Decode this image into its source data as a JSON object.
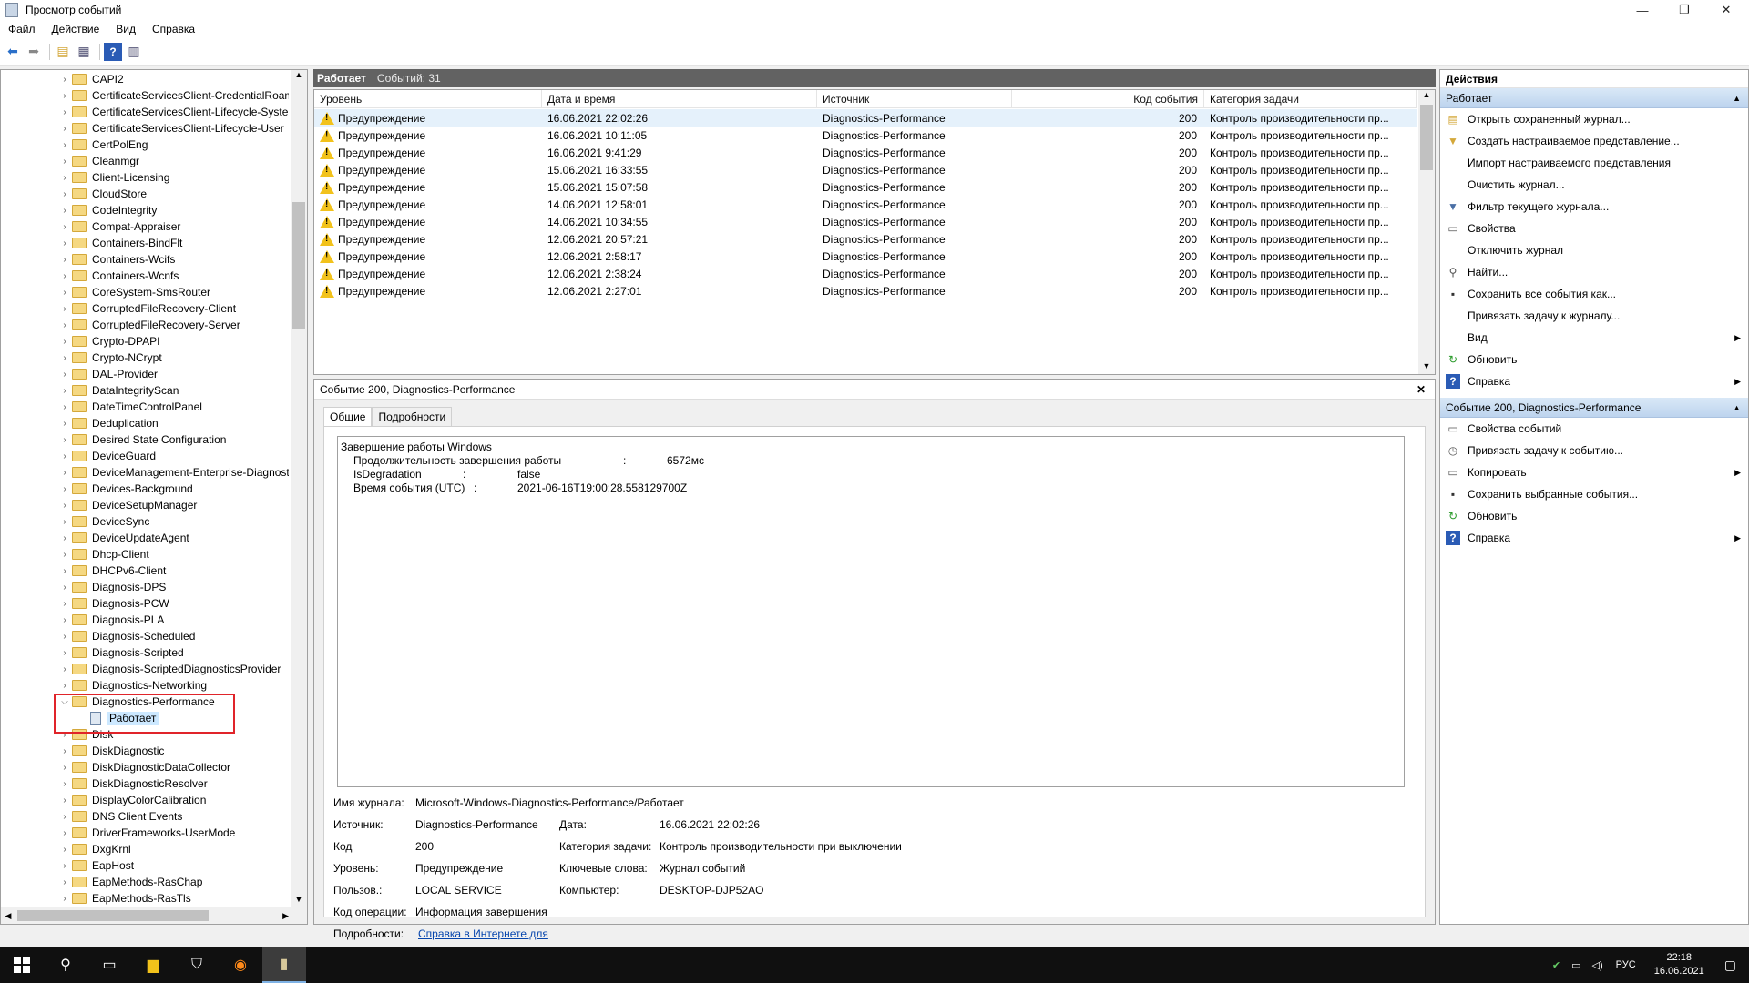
{
  "window": {
    "title": "Просмотр событий",
    "min_label": "—",
    "max_label": "❐",
    "close_label": "✕"
  },
  "menu": [
    "Файл",
    "Действие",
    "Вид",
    "Справка"
  ],
  "toolbar": [
    "back-icon",
    "forward-icon",
    "folder-up-icon",
    "show-hide-tree-icon",
    "help-icon",
    "show-hide-action-pane-icon"
  ],
  "tree": [
    "CAPI2",
    "CertificateServicesClient-CredentialRoam",
    "CertificateServicesClient-Lifecycle-System",
    "CertificateServicesClient-Lifecycle-User",
    "CertPolEng",
    "Cleanmgr",
    "Client-Licensing",
    "CloudStore",
    "CodeIntegrity",
    "Compat-Appraiser",
    "Containers-BindFlt",
    "Containers-Wcifs",
    "Containers-Wcnfs",
    "CoreSystem-SmsRouter",
    "CorruptedFileRecovery-Client",
    "CorruptedFileRecovery-Server",
    "Crypto-DPAPI",
    "Crypto-NCrypt",
    "DAL-Provider",
    "DataIntegrityScan",
    "DateTimeControlPanel",
    "Deduplication",
    "Desired State Configuration",
    "DeviceGuard",
    "DeviceManagement-Enterprise-Diagnosti",
    "Devices-Background",
    "DeviceSetupManager",
    "DeviceSync",
    "DeviceUpdateAgent",
    "Dhcp-Client",
    "DHCPv6-Client",
    "Diagnosis-DPS",
    "Diagnosis-PCW",
    "Diagnosis-PLA",
    "Diagnosis-Scheduled",
    "Diagnosis-Scripted",
    "Diagnosis-ScriptedDiagnosticsProvider",
    "Diagnostics-Networking",
    "Diagnostics-Performance",
    "Работает",
    "Disk",
    "DiskDiagnostic",
    "DiskDiagnosticDataCollector",
    "DiskDiagnosticResolver",
    "DisplayColorCalibration",
    "DNS Client Events",
    "DriverFrameworks-UserMode",
    "DxgKrnl",
    "EapHost",
    "EapMethods-RasChap",
    "EapMethods-RasTls"
  ],
  "list": {
    "name": "Работает",
    "count": "Событий: 31",
    "columns": [
      "Уровень",
      "Дата и время",
      "Источник",
      "Код события",
      "Категория задачи"
    ],
    "rows": [
      [
        "Предупреждение",
        "16.06.2021 22:02:26",
        "Diagnostics-Performance",
        "200",
        "Контроль производительности пр..."
      ],
      [
        "Предупреждение",
        "16.06.2021 10:11:05",
        "Diagnostics-Performance",
        "200",
        "Контроль производительности пр..."
      ],
      [
        "Предупреждение",
        "16.06.2021 9:41:29",
        "Diagnostics-Performance",
        "200",
        "Контроль производительности пр..."
      ],
      [
        "Предупреждение",
        "15.06.2021 16:33:55",
        "Diagnostics-Performance",
        "200",
        "Контроль производительности пр..."
      ],
      [
        "Предупреждение",
        "15.06.2021 15:07:58",
        "Diagnostics-Performance",
        "200",
        "Контроль производительности пр..."
      ],
      [
        "Предупреждение",
        "14.06.2021 12:58:01",
        "Diagnostics-Performance",
        "200",
        "Контроль производительности пр..."
      ],
      [
        "Предупреждение",
        "14.06.2021 10:34:55",
        "Diagnostics-Performance",
        "200",
        "Контроль производительности пр..."
      ],
      [
        "Предупреждение",
        "12.06.2021 20:57:21",
        "Diagnostics-Performance",
        "200",
        "Контроль производительности пр..."
      ],
      [
        "Предупреждение",
        "12.06.2021 2:58:17",
        "Diagnostics-Performance",
        "200",
        "Контроль производительности пр..."
      ],
      [
        "Предупреждение",
        "12.06.2021 2:38:24",
        "Diagnostics-Performance",
        "200",
        "Контроль производительности пр..."
      ],
      [
        "Предупреждение",
        "12.06.2021 2:27:01",
        "Diagnostics-Performance",
        "200",
        "Контроль производительности пр..."
      ]
    ]
  },
  "detail": {
    "title": "Событие 200, Diagnostics-Performance",
    "close": "✕",
    "tab_general": "Общие",
    "tab_details": "Подробности",
    "desc": {
      "heading": "Завершение работы Windows",
      "l1k": "Продолжительность завершения работы",
      "l1v": "6572мс",
      "l2k": "IsDegradation",
      "l2v": "false",
      "l3k": "Время события (UTC)",
      "l3v": "2021-06-16T19:00:28.558129700Z",
      "sep": ":"
    },
    "props": {
      "log_k": "Имя журнала:",
      "log_v": "Microsoft-Windows-Diagnostics-Performance/Работает",
      "src_k": "Источник:",
      "src_v": "Diagnostics-Performance",
      "date_k": "Дата:",
      "date_v": "16.06.2021 22:02:26",
      "code_k": "Код",
      "code_v": "200",
      "cat_k": "Категория задачи:",
      "cat_v": "Контроль производительности при выключении",
      "lvl_k": "Уровень:",
      "lvl_v": "Предупреждение",
      "kw_k": "Ключевые слова:",
      "kw_v": "Журнал событий",
      "user_k": "Пользов.:",
      "user_v": "LOCAL SERVICE",
      "comp_k": "Компьютер:",
      "comp_v": "DESKTOP-DJP52AO",
      "op_k": "Код операции:",
      "op_v": "Информация завершения",
      "more_k": "Подробности:",
      "more_v": "Справка в Интернете для"
    }
  },
  "actions": {
    "title": "Действия",
    "sec1": "Работает",
    "items1": [
      "Открыть сохраненный журнал...",
      "Создать настраиваемое представление...",
      "Импорт настраиваемого представления",
      "Очистить журнал...",
      "Фильтр текущего журнала...",
      "Свойства",
      "Отключить журнал",
      "Найти...",
      "Сохранить все события как...",
      "Привязать задачу к журналу...",
      "Вид",
      "Обновить",
      "Справка"
    ],
    "sec2": "Событие 200, Diagnostics-Performance",
    "items2": [
      "Свойства событий",
      "Привязать задачу к событию...",
      "Копировать",
      "Сохранить выбранные события...",
      "Обновить",
      "Справка"
    ]
  },
  "taskbar": {
    "lang": "РУС",
    "time": "22:18",
    "date": "16.06.2021"
  },
  "colors": {
    "warning": "#f2c21b",
    "section": "#bdd4ee",
    "highlight": "#e0242a",
    "list_header": "#626262"
  }
}
